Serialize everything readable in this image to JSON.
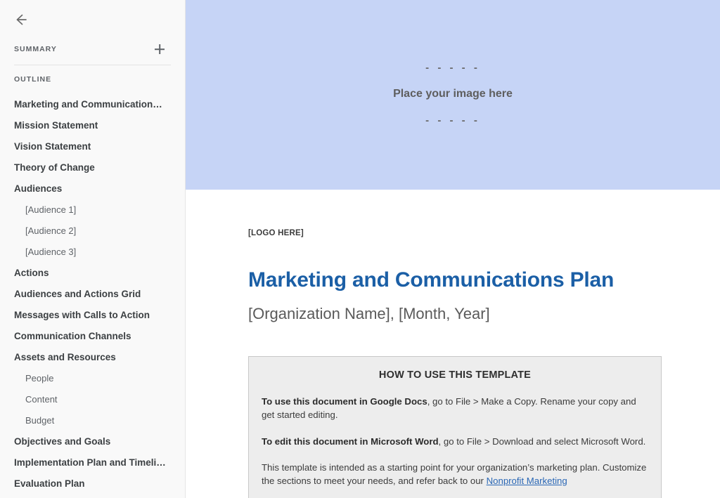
{
  "sidebar": {
    "back_icon": "back-arrow-icon",
    "summary": {
      "label": "SUMMARY",
      "add_icon": "plus-icon"
    },
    "outline": {
      "label": "OUTLINE",
      "items": [
        {
          "label": "Marketing and Communication…",
          "level": 0
        },
        {
          "label": "Mission Statement",
          "level": 0
        },
        {
          "label": "Vision Statement",
          "level": 0
        },
        {
          "label": "Theory of Change",
          "level": 0
        },
        {
          "label": "Audiences",
          "level": 0
        },
        {
          "label": "[Audience 1]",
          "level": 1
        },
        {
          "label": "[Audience 2]",
          "level": 1
        },
        {
          "label": "[Audience 3]",
          "level": 1
        },
        {
          "label": "Actions",
          "level": 0
        },
        {
          "label": "Audiences and Actions Grid",
          "level": 0
        },
        {
          "label": "Messages with Calls to Action",
          "level": 0
        },
        {
          "label": "Communication Channels",
          "level": 0
        },
        {
          "label": "Assets and Resources",
          "level": 0
        },
        {
          "label": "People",
          "level": 1
        },
        {
          "label": "Content",
          "level": 1
        },
        {
          "label": "Budget",
          "level": 1
        },
        {
          "label": "Objectives and Goals",
          "level": 0
        },
        {
          "label": "Implementation Plan and Timeli…",
          "level": 0
        },
        {
          "label": "Evaluation Plan",
          "level": 0
        }
      ]
    }
  },
  "document": {
    "banner": {
      "dashes_top": "- - - - -",
      "text": "Place your image here",
      "dashes_bottom": "- - - - -",
      "background_color": "#c6d4f6"
    },
    "logo_placeholder": "[LOGO HERE]",
    "title": "Marketing and Communications Plan",
    "title_color": "#1b5fa6",
    "subtitle": "[Organization Name], [Month, Year]",
    "howto": {
      "heading": "HOW TO USE THIS TEMPLATE",
      "p1_bold": "To use this document in Google Docs",
      "p1_rest": ", go to File > Make a Copy. Rename your copy and get started editing.",
      "p2_bold": "To edit this document in Microsoft Word",
      "p2_rest": ", go to File > Download and select Microsoft Word.",
      "p3_text": "This template is intended as a starting point for your organization’s marketing plan. Customize the sections to meet your needs, and refer back to our ",
      "p3_link": "Nonprofit Marketing",
      "link_color": "#2a67b5",
      "background_color": "#ededed",
      "border_color": "#c8c8c8"
    }
  }
}
